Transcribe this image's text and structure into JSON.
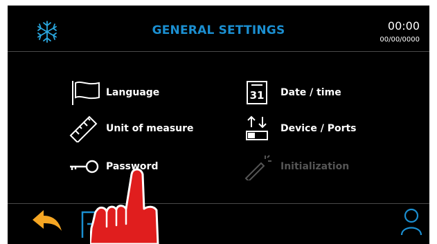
{
  "header": {
    "title": "GENERAL SETTINGS",
    "time": "00:00",
    "date": "00/00/0000",
    "logo_icon": "snowflake-icon"
  },
  "menu": {
    "left": [
      {
        "label": "Language",
        "icon": "flag-icon",
        "enabled": true
      },
      {
        "label": "Unit of measure",
        "icon": "ruler-icon",
        "enabled": true
      },
      {
        "label": "Password",
        "icon": "key-icon",
        "enabled": true
      }
    ],
    "right": [
      {
        "label": "Date / time",
        "icon": "calendar-icon",
        "calendar_day": "31",
        "enabled": true
      },
      {
        "label": "Device / Ports",
        "icon": "ports-icon",
        "enabled": true
      },
      {
        "label": "Initialization",
        "icon": "magic-wand-icon",
        "enabled": false
      }
    ]
  },
  "footer": {
    "back_icon": "back-arrow-icon",
    "exit_icon": "exit-door-icon",
    "user_icon": "user-icon"
  },
  "colors": {
    "accent": "#1b8fd1",
    "back_arrow": "#f5a623",
    "hand": "#e01e1e",
    "background": "#000000",
    "disabled": "#555555"
  }
}
